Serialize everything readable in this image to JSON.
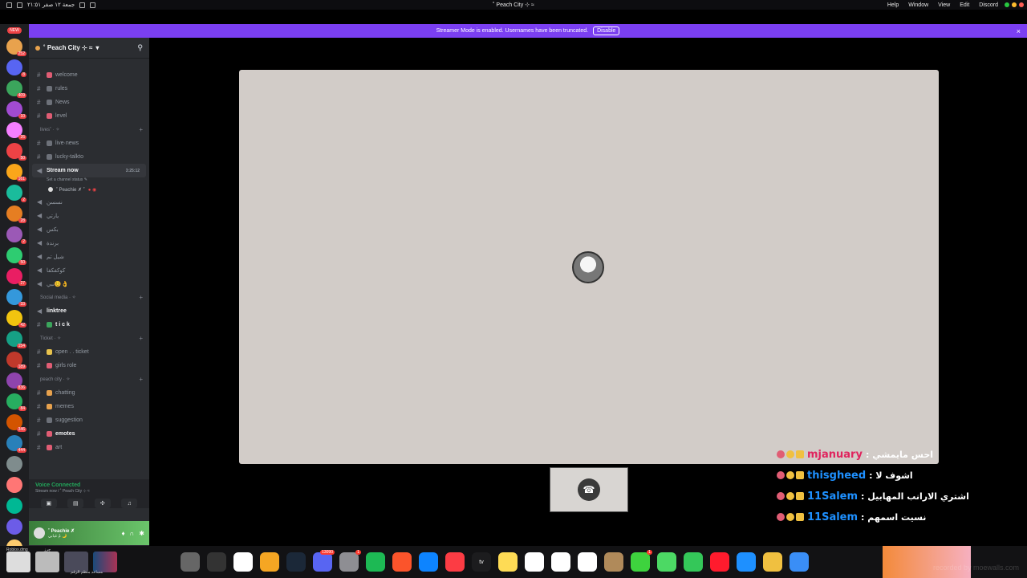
{
  "menubar": {
    "system_date": "جمعة ١٢ صفر ٢١:٥١",
    "window_title": "˚ Peach City ⊹ ≈",
    "menus": [
      "Help",
      "Window",
      "View",
      "Edit",
      "Discord"
    ]
  },
  "banner": {
    "text": "Streamer Mode is enabled. Usernames have been truncated.",
    "button": "Disable",
    "close": "×"
  },
  "servers": {
    "new_label": "NEW",
    "badges": [
      "252",
      "8",
      "409",
      "10",
      "26",
      "50",
      "161",
      "2",
      "28",
      "2",
      "50",
      "27",
      "33",
      "42",
      "154",
      "189",
      "836",
      "84",
      "346",
      "444"
    ],
    "colors": [
      "#e8a24d",
      "#5865f2",
      "#3ba55c",
      "#a14bd1",
      "#f47fff",
      "#ed4245",
      "#faa61a",
      "#1abc9c",
      "#e67e22",
      "#9b59b6",
      "#2ecc71",
      "#e91e63",
      "#3498db",
      "#f1c40f",
      "#16a085",
      "#c0392b",
      "#8e44ad",
      "#27ae60",
      "#d35400",
      "#2980b9",
      "#7f8c8d",
      "#ff7675",
      "#00b894",
      "#6c5ce7",
      "#fdcb6e"
    ]
  },
  "guild": {
    "name": "˚ Peach City ⊹ ≈",
    "channels": [
      {
        "type": "text",
        "label": "welcome",
        "color": "#e05d74"
      },
      {
        "type": "text",
        "label": "rules",
        "color": "#6d7179"
      },
      {
        "type": "text",
        "label": "News",
        "color": "#6d7179"
      },
      {
        "type": "text",
        "label": "level",
        "color": "#e05d74"
      },
      {
        "type": "category",
        "label": "lives˚ · ✧"
      },
      {
        "type": "text",
        "label": "live·news",
        "color": "#6d7179"
      },
      {
        "type": "text",
        "label": "lucky-talkto",
        "color": "#6d7179"
      },
      {
        "type": "voice-active",
        "label": "Stream now",
        "timer": "3:25:12",
        "status": "Set a channel status ✎",
        "member": "˚ Peachie ✗ ˚"
      },
      {
        "type": "voice",
        "label": "نسسن"
      },
      {
        "type": "voice",
        "label": "يارتي"
      },
      {
        "type": "voice",
        "label": "بكس"
      },
      {
        "type": "voice",
        "label": "برندة"
      },
      {
        "type": "voice",
        "label": "شيل تم"
      },
      {
        "type": "voice",
        "label": "كوكفكفا"
      },
      {
        "type": "voice",
        "label": "نبي😊👌"
      },
      {
        "type": "category",
        "label": "Social media · ✧"
      },
      {
        "type": "voice",
        "label": "linktree",
        "bold": true
      },
      {
        "type": "text",
        "label": "t i c k",
        "color": "#3ba55c",
        "bold": true
      },
      {
        "type": "category",
        "label": "Ticket · ✧"
      },
      {
        "type": "text",
        "label": "open . . ticket",
        "color": "#e8c34d"
      },
      {
        "type": "text",
        "label": "girls role",
        "color": "#e05d74"
      },
      {
        "type": "category",
        "label": "peach city · ✧"
      },
      {
        "type": "text",
        "label": "chatting",
        "color": "#e8a24d"
      },
      {
        "type": "text",
        "label": "memes",
        "color": "#e8a24d"
      },
      {
        "type": "text",
        "label": "suggestion",
        "color": "#6d7179"
      },
      {
        "type": "text",
        "label": "emotes",
        "color": "#e05d74",
        "bold": true
      },
      {
        "type": "text",
        "label": "art",
        "color": "#e05d74"
      }
    ]
  },
  "voice_connected": {
    "title": "Voice Connected",
    "subtitle": "Stream now / ˚ Peach City ⊹ ≈",
    "actions": [
      "video",
      "screen",
      "activities",
      "soundboard"
    ]
  },
  "user": {
    "name": "˚ Peachie ✗",
    "status": "مُ غيابي 🌙"
  },
  "chat_overlay": [
    {
      "user": "mjanuary",
      "msg": ": احس مايمشي",
      "user_color": "#e0245e"
    },
    {
      "user": "thisgheed",
      "msg": ": اشوف لا",
      "user_color": "#1e90ff"
    },
    {
      "user": "11Salem",
      "msg": ": اشتري الارانب المهابيل",
      "user_color": "#1e90ff"
    },
    {
      "user": "11Salem",
      "msg": ": نسيت اسمهم",
      "user_color": "#1e90ff"
    }
  ],
  "dock": {
    "left_labels": [
      "Roblox.dmg",
      "حِرز",
      "مساعد منظم الرقم"
    ],
    "apps": [
      {
        "name": "trash-icon",
        "color": "#666"
      },
      {
        "name": "terminal-icon",
        "color": "#333"
      },
      {
        "name": "chrome-icon",
        "color": "#fff"
      },
      {
        "name": "launchpad-icon",
        "color": "#f5a623"
      },
      {
        "name": "steam-icon",
        "color": "#1b2838"
      },
      {
        "name": "discord-icon",
        "color": "#5865f2",
        "badge": "13090"
      },
      {
        "name": "settings-icon",
        "color": "#8e8e93",
        "badge": "1"
      },
      {
        "name": "spotify-icon",
        "color": "#1db954"
      },
      {
        "name": "brave-icon",
        "color": "#fb542b"
      },
      {
        "name": "app-store-icon",
        "color": "#0d84ff"
      },
      {
        "name": "music-icon",
        "color": "#fc3c44"
      },
      {
        "name": "apple-tv-icon",
        "color": "#1c1c1e",
        "label": "tv"
      },
      {
        "name": "notes-icon",
        "color": "#fedb55"
      },
      {
        "name": "freeform-icon",
        "color": "#fff"
      },
      {
        "name": "reminders-icon",
        "color": "#fff"
      },
      {
        "name": "calendar-icon",
        "color": "#fff"
      },
      {
        "name": "tools-icon",
        "color": "#b08a5a"
      },
      {
        "name": "facetime-icon",
        "color": "#3ed33e",
        "badge": "1"
      },
      {
        "name": "maps-icon",
        "color": "#4cd964"
      },
      {
        "name": "messages-icon",
        "color": "#34c759"
      },
      {
        "name": "opera-icon",
        "color": "#ff1b2d"
      },
      {
        "name": "mail-icon",
        "color": "#1e90ff"
      },
      {
        "name": "photos-icon",
        "color": "#f0c040"
      },
      {
        "name": "finder-icon",
        "color": "#3a8ef6"
      }
    ]
  },
  "watermark": "recorded by moewalls.com"
}
